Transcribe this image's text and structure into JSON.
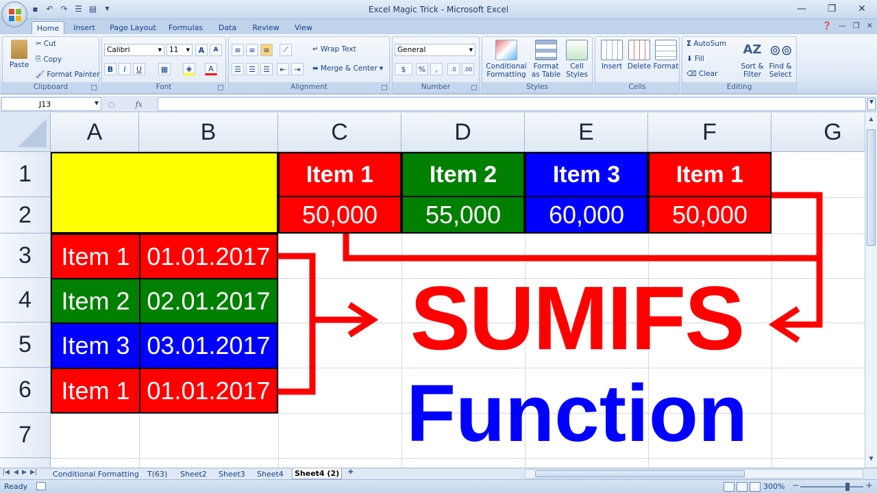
{
  "window": {
    "title": "Excel Magic Trick - Microsoft Excel",
    "minimize": "—",
    "restore": "❐",
    "close": "✕"
  },
  "tabs": [
    "Home",
    "Insert",
    "Page Layout",
    "Formulas",
    "Data",
    "Review",
    "View"
  ],
  "ribbon": {
    "clipboard": {
      "label": "Clipboard",
      "paste": "Paste",
      "cut": "Cut",
      "copy": "Copy",
      "format_painter": "Format Painter"
    },
    "font": {
      "label": "Font",
      "font_name": "Calibri",
      "font_size": "11",
      "grow": "A",
      "shrink": "A",
      "bold": "B",
      "italic": "I",
      "underline": "U",
      "font_color_letter": "A"
    },
    "alignment": {
      "label": "Alignment",
      "wrap_text": "Wrap Text",
      "merge_center": "Merge & Center"
    },
    "number": {
      "label": "Number",
      "format": "General",
      "percent": "%",
      "comma": ","
    },
    "styles": {
      "label": "Styles",
      "conditional_1": "Conditional",
      "conditional_2": "Formatting",
      "format_table_1": "Format",
      "format_table_2": "as Table",
      "cell_styles_1": "Cell",
      "cell_styles_2": "Styles"
    },
    "cells": {
      "label": "Cells",
      "insert": "Insert",
      "delete": "Delete",
      "format": "Format"
    },
    "editing": {
      "label": "Editing",
      "autosum": "AutoSum",
      "fill": "Fill",
      "clear": "Clear",
      "sort_1": "Sort &",
      "sort_2": "Filter",
      "find_1": "Find &",
      "find_2": "Select"
    }
  },
  "formula_bar": {
    "name_box": "J13",
    "fx": "fx",
    "formula": ""
  },
  "columns": [
    "A",
    "B",
    "C",
    "D",
    "E",
    "F",
    "G"
  ],
  "rows": [
    "1",
    "2",
    "3",
    "4",
    "5",
    "6",
    "7"
  ],
  "cells": {
    "header_row": [
      {
        "text": "Item 1",
        "color": "#ff0000"
      },
      {
        "text": "Item 2",
        "color": "#008000"
      },
      {
        "text": "Item 3",
        "color": "#0000ff"
      },
      {
        "text": "Item 1",
        "color": "#ff0000"
      }
    ],
    "value_row": [
      {
        "text": "50,000",
        "color": "#ff0000"
      },
      {
        "text": "55,000",
        "color": "#008000"
      },
      {
        "text": "60,000",
        "color": "#0000ff"
      },
      {
        "text": "50,000",
        "color": "#ff0000"
      }
    ],
    "list": [
      {
        "item": "Item 1",
        "date": "01.01.2017",
        "color": "#ff0000"
      },
      {
        "item": "Item 2",
        "date": "02.01.2017",
        "color": "#008000"
      },
      {
        "item": "Item 3",
        "date": "03.01.2017",
        "color": "#0000ff"
      },
      {
        "item": "Item 1",
        "date": "01.01.2017",
        "color": "#ff0000"
      }
    ],
    "highlight_color": "#ffff00"
  },
  "overlay": {
    "title": "SUMIFS",
    "subtitle": "Function",
    "title_color": "#ff0000",
    "subtitle_color": "#0000ff",
    "arrow_color": "#ff0000"
  },
  "sheet_tabs": [
    "Conditional Formatting",
    "T(63)",
    "Sheet2",
    "Sheet3",
    "Sheet4",
    "Sheet4 (2)"
  ],
  "active_sheet": "Sheet4 (2)",
  "status": {
    "text": "Ready",
    "zoom": "300%"
  }
}
